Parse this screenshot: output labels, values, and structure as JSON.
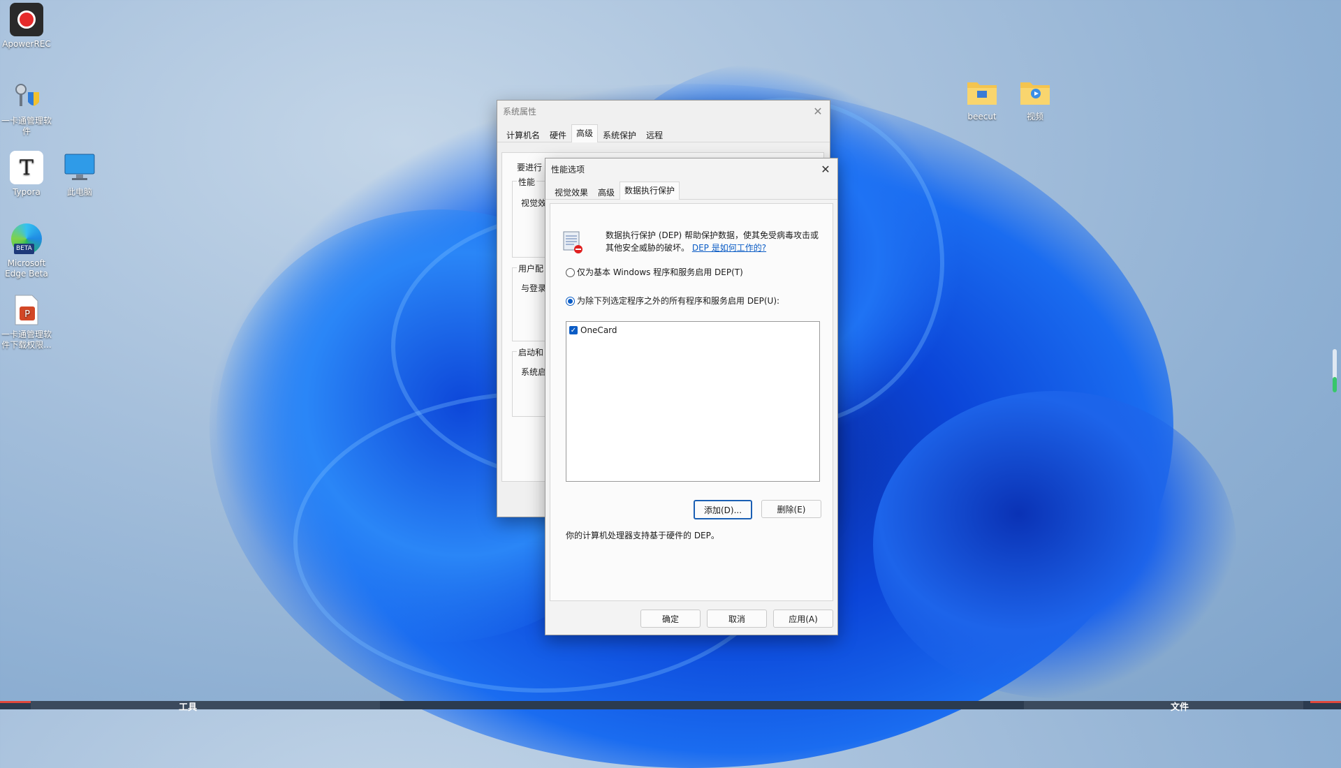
{
  "desktop": {
    "icons": [
      {
        "label": "ApowerREC"
      },
      {
        "label": "一卡通管理软件"
      },
      {
        "label": "Typora"
      },
      {
        "label": "此电脑"
      },
      {
        "label": "Microsoft Edge Beta"
      },
      {
        "label": "一卡通管理软件下载权限..."
      },
      {
        "label": "beecut"
      },
      {
        "label": "视频"
      }
    ]
  },
  "system_props": {
    "title": "系统属性",
    "tabs": [
      "计算机名",
      "硬件",
      "高级",
      "系统保护",
      "远程"
    ],
    "active_tab": "高级",
    "partial_texts": [
      "要进行",
      "性能",
      "视觉效",
      "用户配",
      "与登录",
      "启动和",
      "系统启"
    ]
  },
  "perf_options": {
    "title": "性能选项",
    "tabs": [
      "视觉效果",
      "高级",
      "数据执行保护"
    ],
    "active_tab": "数据执行保护",
    "description": "数据执行保护 (DEP) 帮助保护数据，使其免受病毒攻击或其他安全威胁的破坏。",
    "help_link": "DEP 是如何工作的?",
    "option1": "仅为基本 Windows 程序和服务启用 DEP(T)",
    "option2": "为除下列选定程序之外的所有程序和服务启用 DEP(U):",
    "list_items": [
      {
        "name": "OneCard",
        "checked": true
      }
    ],
    "add_button": "添加(D)...",
    "remove_button": "删除(E)",
    "support_text": "你的计算机处理器支持基于硬件的 DEP。",
    "ok_button": "确定",
    "cancel_button": "取消",
    "apply_button": "应用(A)"
  },
  "taskbar": {
    "left_label": "工具",
    "right_label": "文件"
  },
  "colors": {
    "accent": "#0b5cc5",
    "link": "#0b5cc5"
  }
}
